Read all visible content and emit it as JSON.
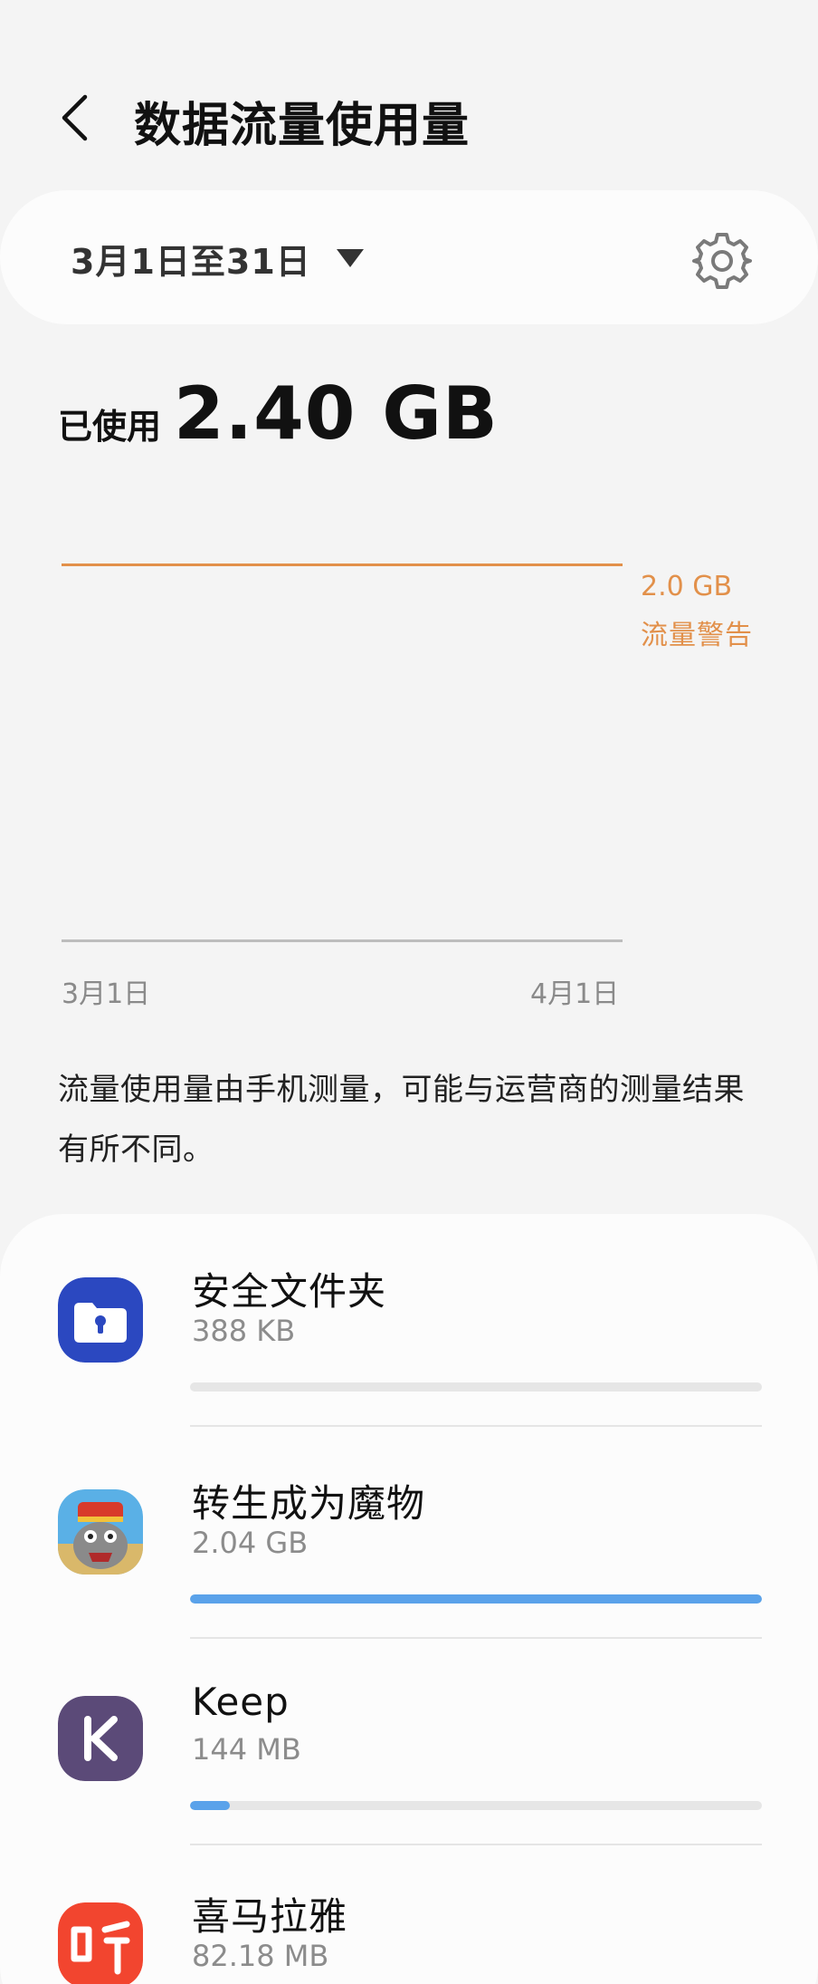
{
  "header": {
    "title": "数据流量使用量",
    "back_icon": "chevron-left-icon"
  },
  "period": {
    "label": "3月1日至31日",
    "dropdown_icon": "triangle-down-icon",
    "settings_icon": "gear-icon"
  },
  "usage": {
    "used_label": "已使用",
    "used_value": "2.40 GB"
  },
  "chart": {
    "warning_value": "2.0 GB",
    "warning_label": "流量警告",
    "start_label": "3月1日",
    "end_label": "4月1日",
    "warning_color": "#e2904a"
  },
  "note": "流量使用量由手机测量，可能与运营商的测量结果有所不同。",
  "apps": [
    {
      "name": "安全文件夹",
      "size": "388 KB",
      "usage_fraction": 0.0,
      "icon": "secure-folder-icon"
    },
    {
      "name": "转生成为魔物",
      "size": "2.04 GB",
      "usage_fraction": 1.0,
      "icon": "game-monster-icon"
    },
    {
      "name": "Keep",
      "size": "144 MB",
      "usage_fraction": 0.07,
      "icon": "keep-app-icon"
    },
    {
      "name": "喜马拉雅",
      "size": "82.18 MB",
      "usage_fraction": 0.04,
      "icon": "ximalaya-icon"
    }
  ],
  "colors": {
    "accent_bar": "#5aa2ea",
    "secure_folder": "#2b48c0",
    "keep": "#5b4a78",
    "ximalaya": "#f2452f"
  }
}
